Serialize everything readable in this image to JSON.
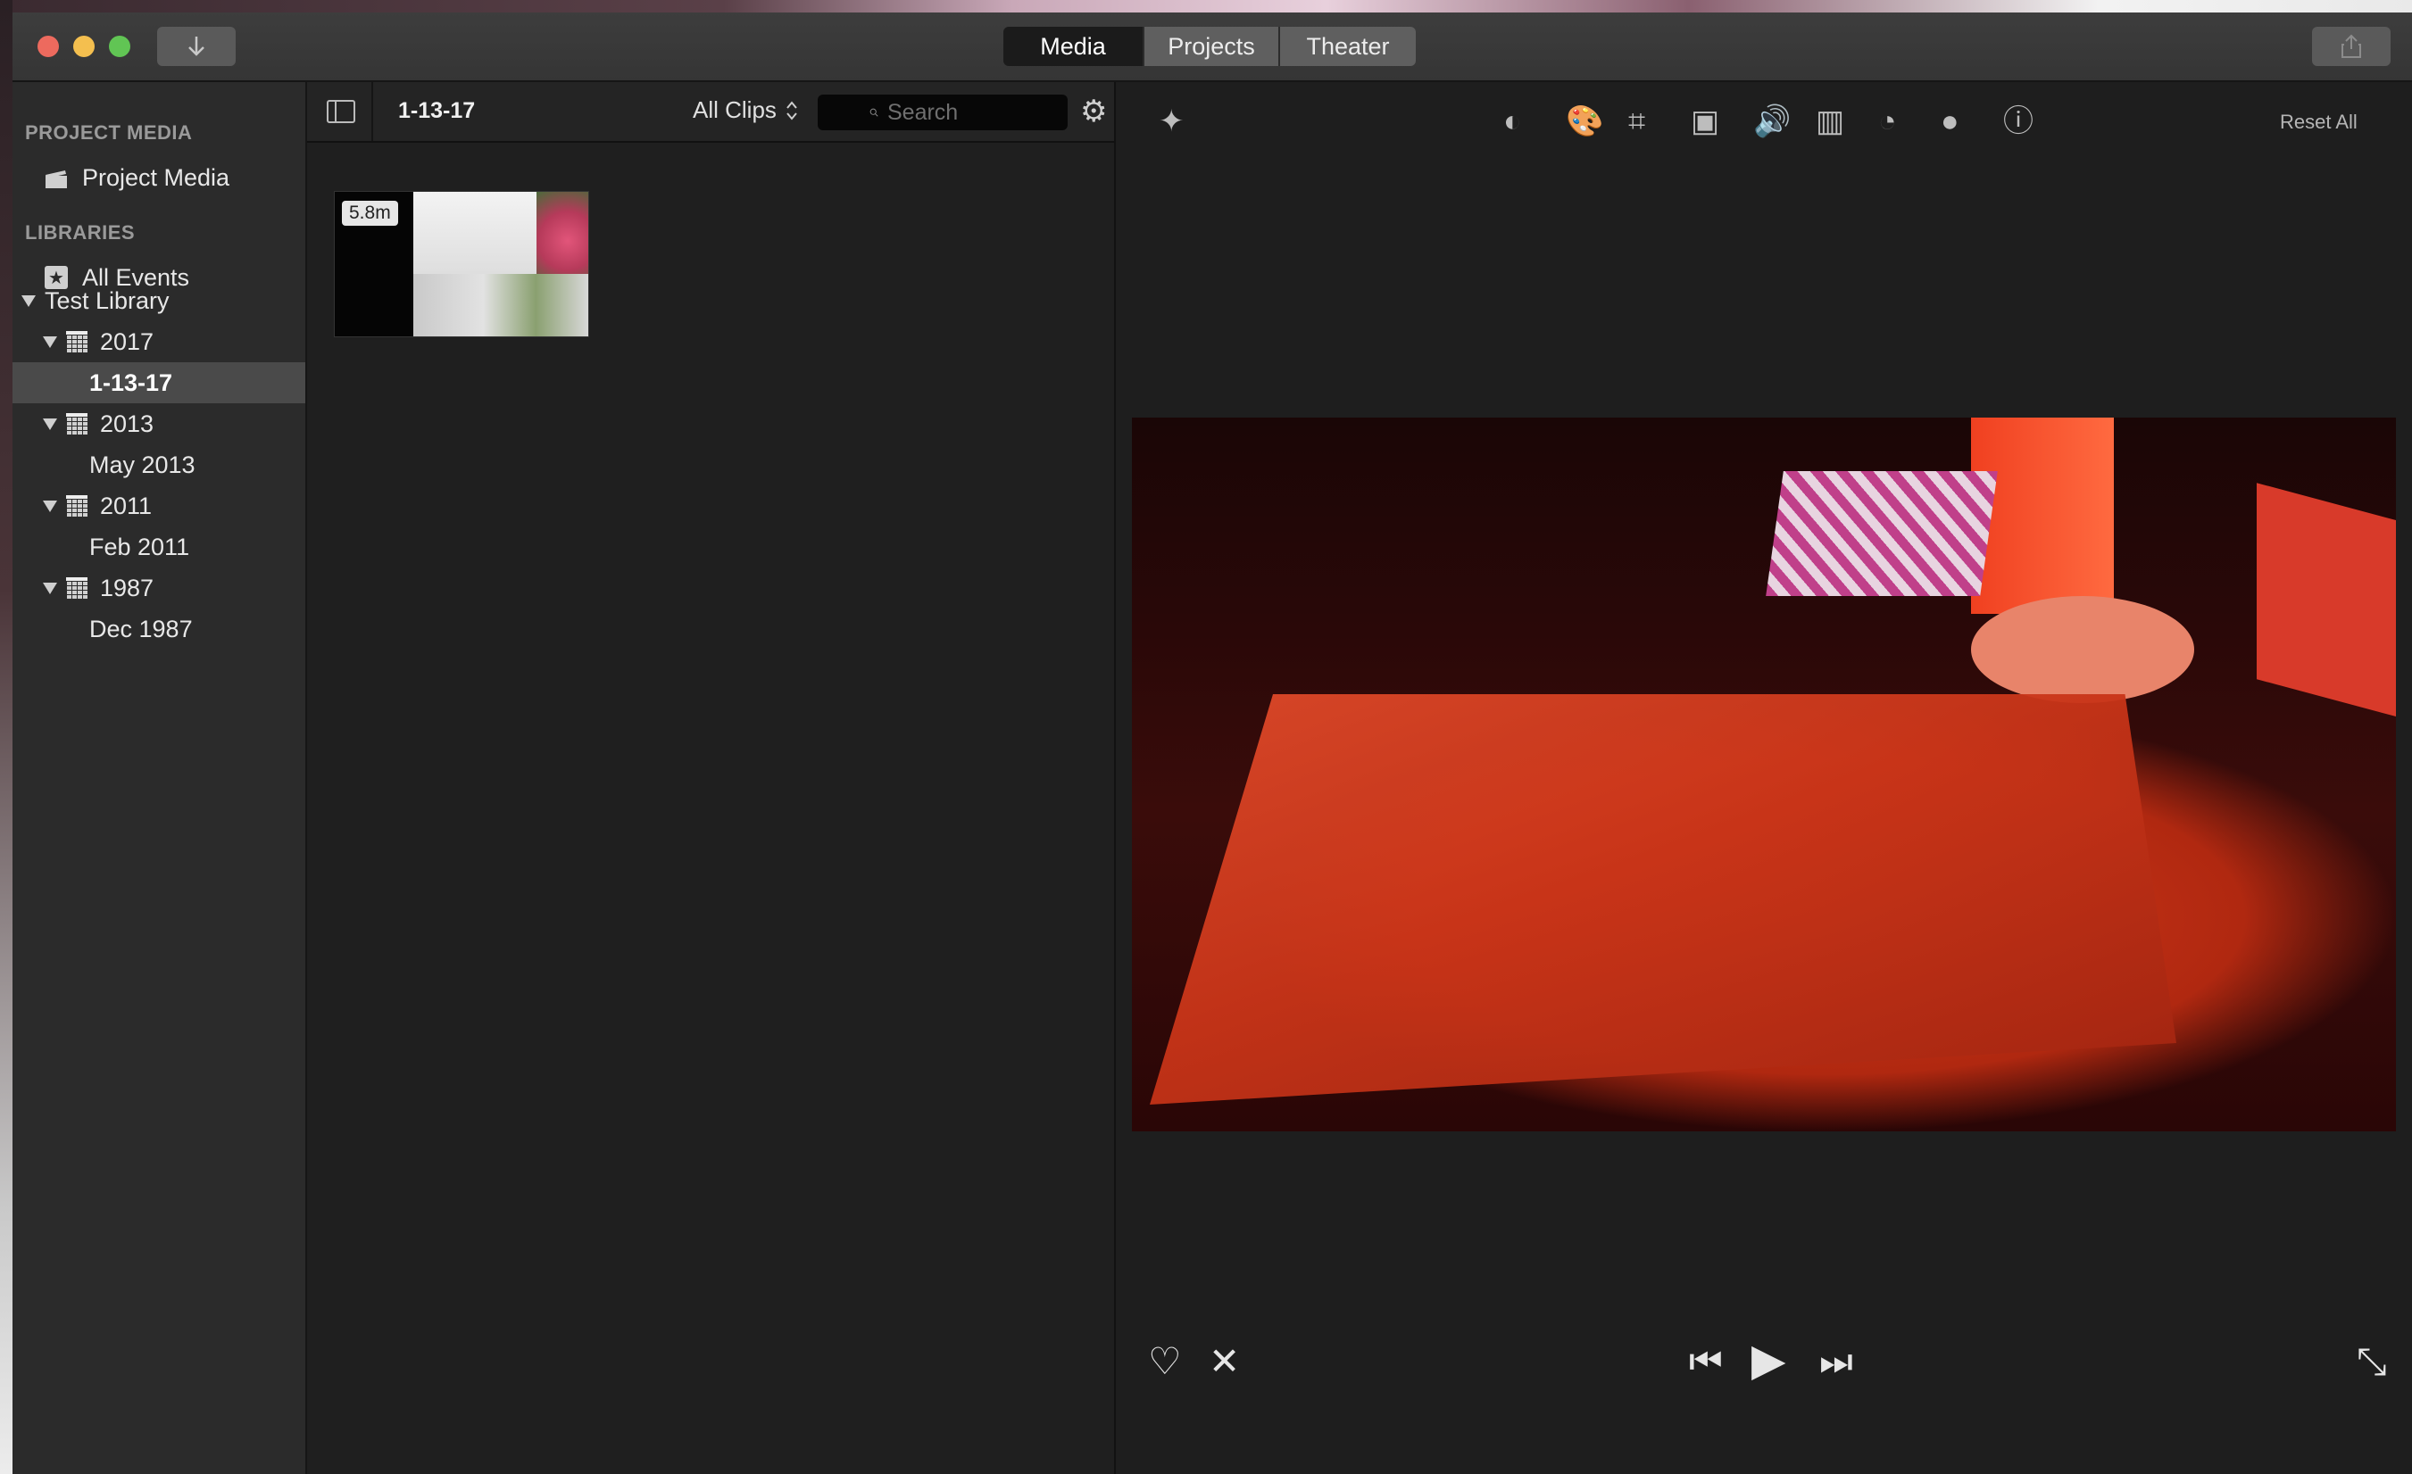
{
  "window": {
    "titlebar": {
      "import_icon": "down-arrow-icon",
      "tabs": [
        {
          "label": "Media",
          "active": true
        },
        {
          "label": "Projects",
          "active": false
        },
        {
          "label": "Theater",
          "active": false
        }
      ],
      "share_icon": "share-icon"
    }
  },
  "sidebar": {
    "project_media_header": "PROJECT MEDIA",
    "project_media_item": "Project Media",
    "libraries_header": "LIBRARIES",
    "all_events": "All Events",
    "library": "Test Library",
    "years": [
      {
        "label": "2017",
        "events": [
          "1-13-17"
        ]
      },
      {
        "label": "2013",
        "events": [
          "May 2013"
        ]
      },
      {
        "label": "2011",
        "events": [
          "Feb 2011"
        ]
      },
      {
        "label": "1987",
        "events": [
          "Dec 1987"
        ]
      }
    ],
    "selected_event": "1-13-17"
  },
  "browser": {
    "event_title": "1-13-17",
    "filter_label": "All Clips",
    "search_placeholder": "Search",
    "clips": [
      {
        "duration": "5.8m"
      }
    ]
  },
  "viewer": {
    "tools": [
      "magic-wand-icon",
      "color-balance-icon",
      "color-correction-icon",
      "crop-icon",
      "stabilization-icon",
      "volume-icon",
      "equalizer-icon",
      "speed-icon",
      "clip-filter-icon",
      "info-icon"
    ],
    "reset_all": "Reset All",
    "transport": {
      "favorite_icon": "heart-icon",
      "reject_icon": "reject-icon",
      "prev_icon": "skip-back-icon",
      "play_icon": "play-icon",
      "next_icon": "skip-forward-icon",
      "fullscreen_icon": "fullscreen-icon"
    }
  }
}
